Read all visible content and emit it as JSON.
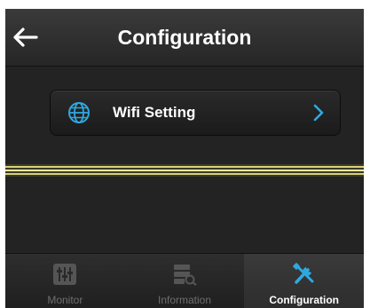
{
  "navbar": {
    "title": "Configuration",
    "back_icon": "arrow-left-icon"
  },
  "settings": {
    "items": [
      {
        "label": "Wifi Setting",
        "icon": "globe-icon",
        "accessory": "chevron-right-icon"
      }
    ]
  },
  "tabbar": {
    "tabs": [
      {
        "label": "Monitor",
        "icon": "sliders-icon",
        "active": false
      },
      {
        "label": "Information",
        "icon": "database-search-icon",
        "active": false
      },
      {
        "label": "Configuration",
        "icon": "tools-icon",
        "active": true
      }
    ]
  },
  "colors": {
    "accent": "#2fa8e0",
    "divider_yellow": "#e8e17a",
    "background": "#232323",
    "inactive_text": "#6e6e6e"
  }
}
